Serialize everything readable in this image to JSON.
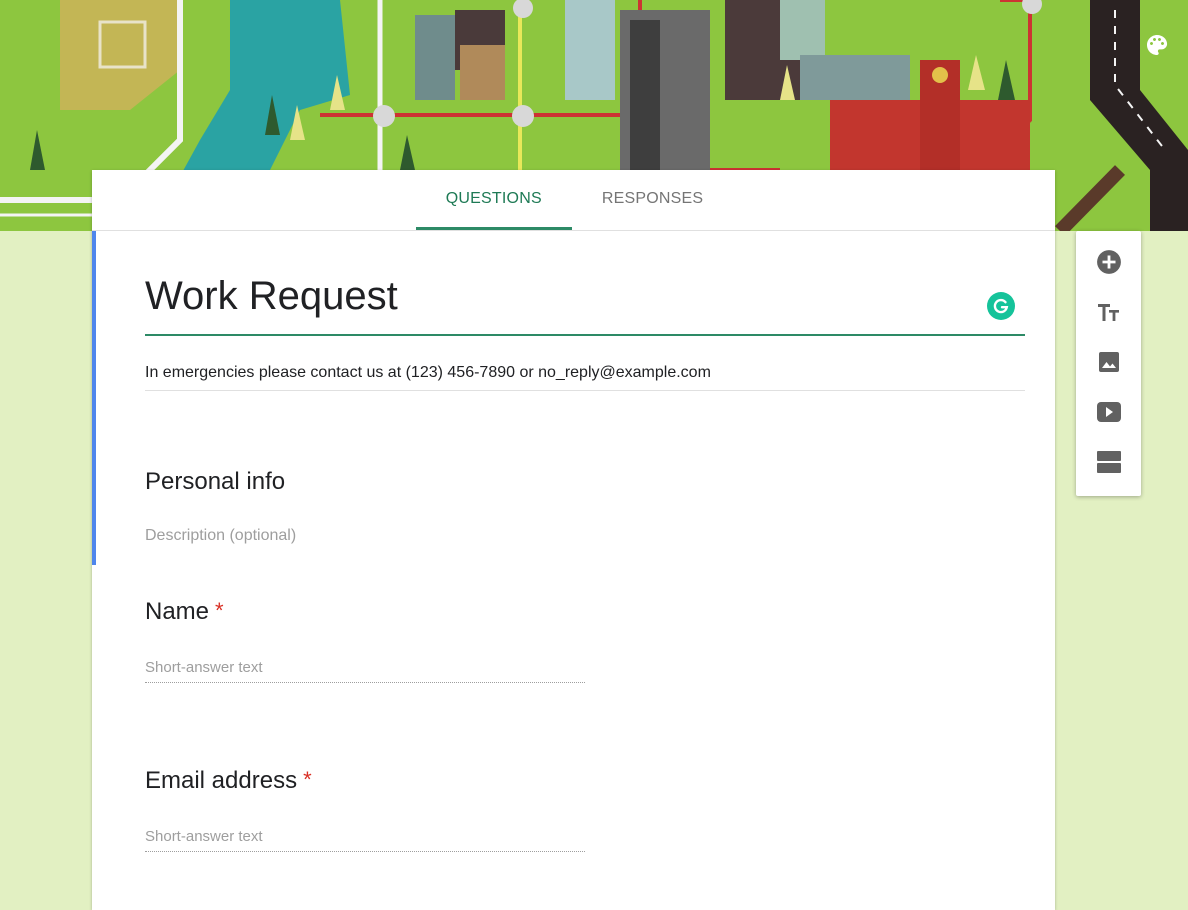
{
  "tabs": [
    {
      "label": "QUESTIONS",
      "active": true
    },
    {
      "label": "RESPONSES",
      "active": false
    }
  ],
  "form": {
    "title": "Work Request",
    "description": "In emergencies please contact us at (123) 456-7890 or no_reply@example.com"
  },
  "section": {
    "title": "Personal info",
    "description_placeholder": "Description (optional)"
  },
  "questions": [
    {
      "title": "Name",
      "required_mark": "*",
      "placeholder": "Short-answer text"
    },
    {
      "title": "Email address",
      "required_mark": "*",
      "placeholder": "Short-answer text"
    }
  ],
  "toolbar": {
    "items": [
      {
        "icon": "add-circle-icon"
      },
      {
        "icon": "title-text-icon"
      },
      {
        "icon": "image-icon"
      },
      {
        "icon": "video-icon"
      },
      {
        "icon": "section-icon"
      }
    ]
  },
  "theme": {
    "accent": "#2d8a66",
    "section_bar": "#4f86ec",
    "background": "#e2f0c2",
    "required": "#d93025"
  }
}
